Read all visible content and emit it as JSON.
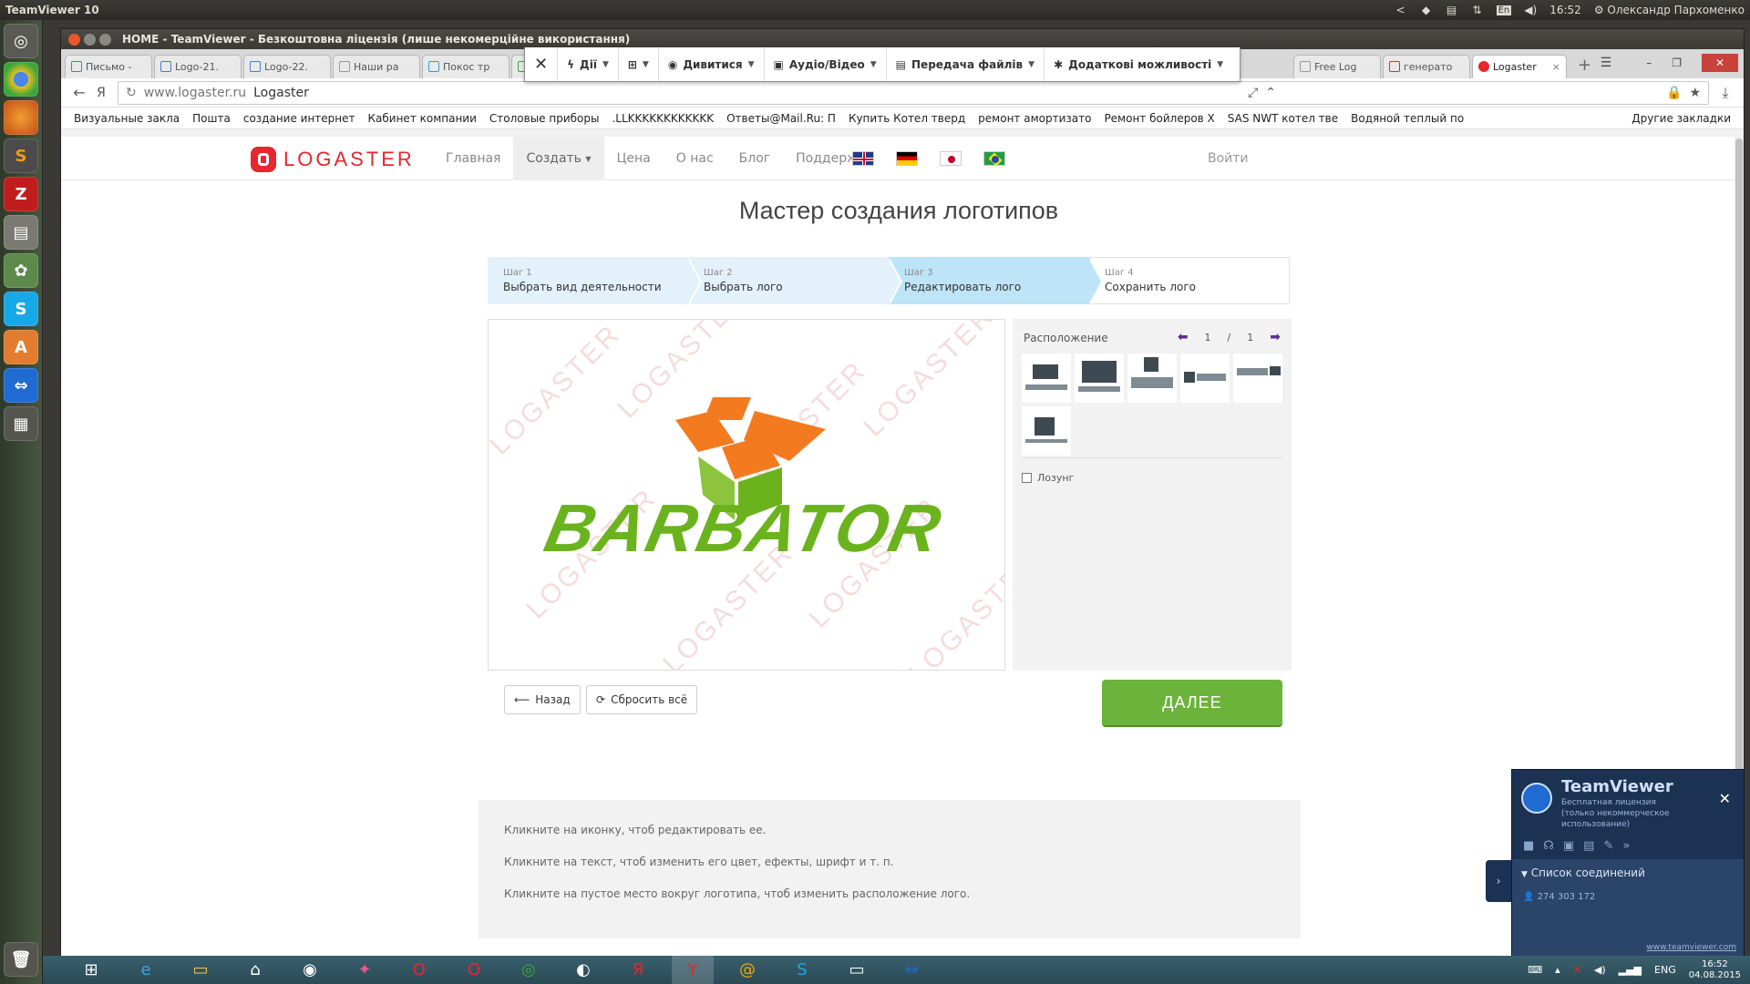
{
  "ubuntu": {
    "app_title": "TeamViewer 10",
    "time": "16:52",
    "user": "Олександр Пархоменко",
    "keyboard_layout": "En"
  },
  "window": {
    "title": "HOME - TeamViewer - Безкоштовна ліцензія (лише некомерційне використання)"
  },
  "tabs": [
    {
      "label": "Письмо -"
    },
    {
      "label": "Logo-21."
    },
    {
      "label": "Logo-22."
    },
    {
      "label": "Наши ра"
    },
    {
      "label": "Покос тр"
    },
    {
      "label": "Free Log"
    },
    {
      "label": "генерато"
    },
    {
      "label": "Logaster",
      "active": true
    }
  ],
  "tv_toolbar": {
    "actions": "Дії",
    "view": "Дивитися",
    "audio_video": "Аудіо/Відео",
    "file_transfer": "Передача файлів",
    "extras": "Додаткові можливості"
  },
  "addressbar": {
    "url_host": "www.logaster.ru",
    "page_title": "Logaster",
    "yandex": "Я"
  },
  "bookmarks": [
    "Визуальные закла",
    "Пошта",
    "создание интернет",
    "Кабинет компании",
    "Столовые приборы",
    ".LLKKKKKKKKKKKK",
    "Ответы@Mail.Ru: П",
    "Купить Котел тверд",
    "ремонт амортизато",
    "Ремонт бойлеров Х",
    "SAS NWT котел тве",
    "Водяной теплый по"
  ],
  "bookmarks_other": "Другие закладки",
  "site": {
    "logo_text": "LOGASTER",
    "menu": {
      "home": "Главная",
      "create": "Создать",
      "price": "Цена",
      "about": "О нас",
      "blog": "Блог",
      "support": "Поддержка"
    },
    "login": "Войти",
    "wizard_title": "Мастер создания логотипов"
  },
  "steps": [
    {
      "num": "Шаг 1",
      "label": "Выбрать вид деятельности",
      "state": "done"
    },
    {
      "num": "Шаг 2",
      "label": "Выбрать лого",
      "state": "done"
    },
    {
      "num": "Шаг 3",
      "label": "Редактировать лого",
      "state": "current"
    },
    {
      "num": "Шаг 4",
      "label": "Сохранить лого",
      "state": "todo"
    }
  ],
  "canvas": {
    "brand": "BARBATOR",
    "watermark": "LOGASTER",
    "colors": {
      "orange": "#f47a20",
      "green": "#6ab31d"
    }
  },
  "side": {
    "layout_label": "Расположение",
    "page_current": "1",
    "page_sep": "/",
    "page_total": "1",
    "slogan_label": "Лозунг"
  },
  "buttons": {
    "back": "Назад",
    "reset": "Сбросить всё",
    "next": "ДАЛЕЕ"
  },
  "hints": [
    "Кликните на иконку, чтоб редактировать ее.",
    "Кликните на текст, чтоб изменить его цвет, ефекты, шрифт и т. п.",
    "Кликните на пустое место вокруг логотипа, чтоб изменить расположение лого."
  ],
  "tv_panel": {
    "name": "TeamViewer",
    "license": "Бесплатная лицензия (только некоммерческое использование)",
    "connections_title": "Список соединений",
    "connection_id": "274 303 172",
    "website": "www.teamviewer.com"
  },
  "taskbar": {
    "lang": "ENG",
    "time": "16:52",
    "date": "04.08.2015"
  }
}
